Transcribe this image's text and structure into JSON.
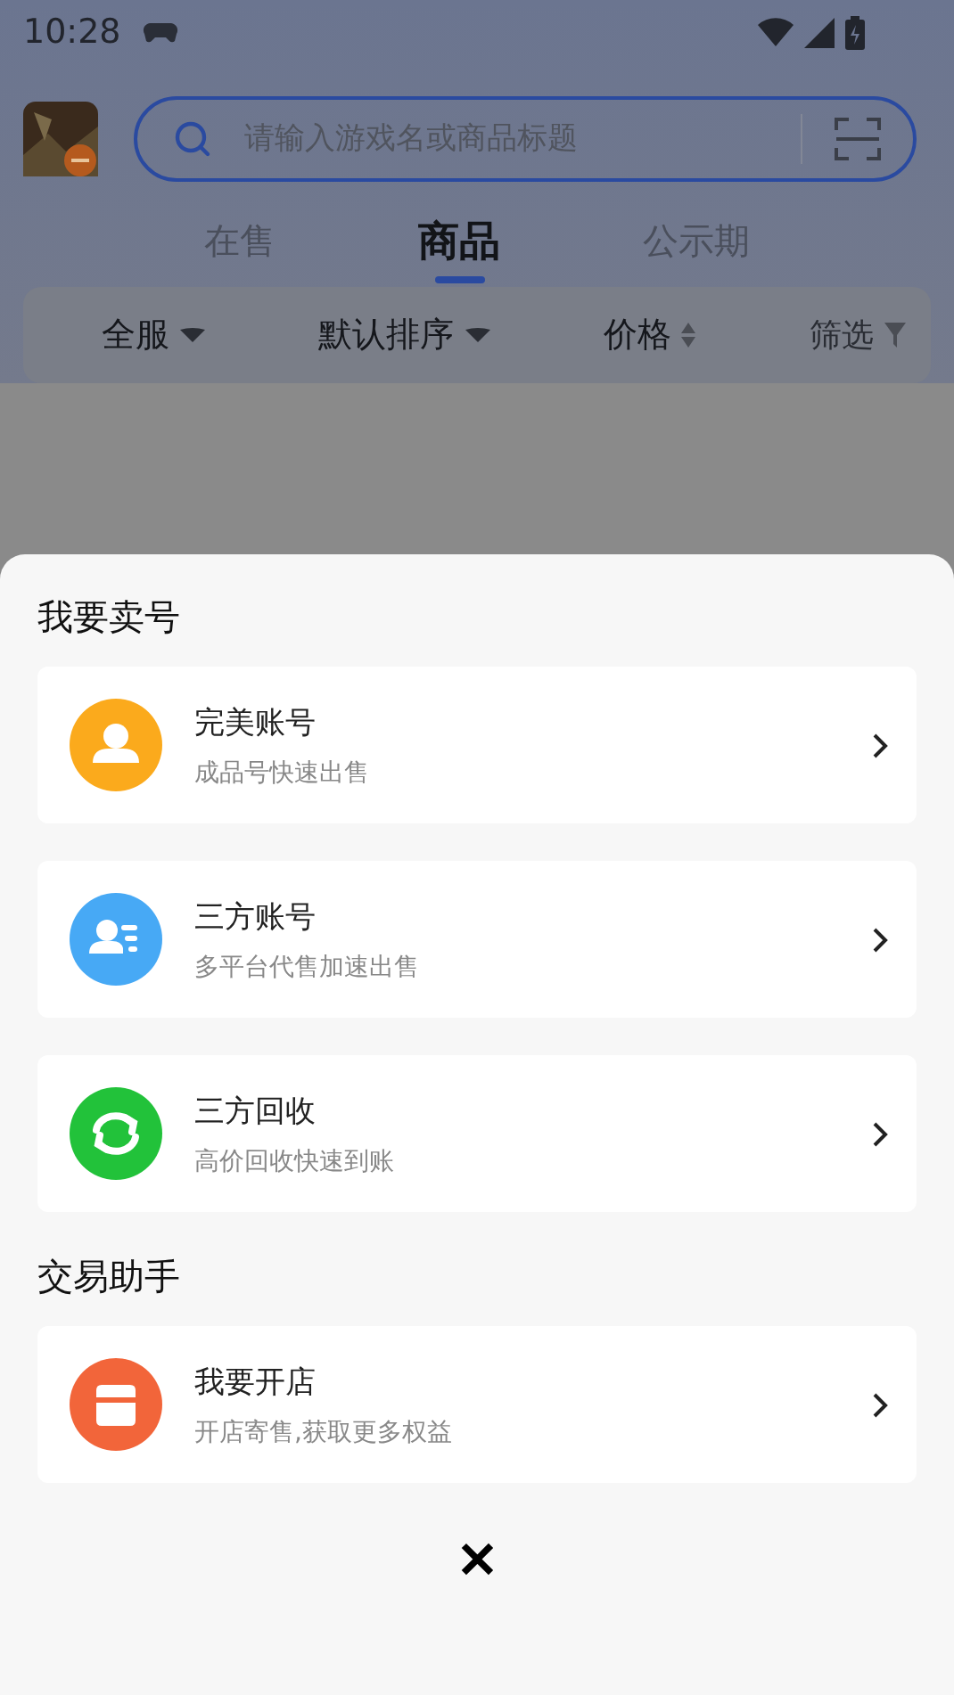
{
  "status_bar": {
    "time": "10:28"
  },
  "search": {
    "placeholder": "请输入游戏名或商品标题"
  },
  "tabs": [
    {
      "label": "在售",
      "selected": false
    },
    {
      "label": "商品",
      "selected": true
    },
    {
      "label": "公示期",
      "selected": false
    }
  ],
  "filters": [
    {
      "label": "全服",
      "kind": "dropdown"
    },
    {
      "label": "默认排序",
      "kind": "dropdown"
    },
    {
      "label": "价格",
      "kind": "sort"
    },
    {
      "label": "筛选",
      "kind": "filter"
    }
  ],
  "sheet": {
    "sections": [
      {
        "title": "我要卖号",
        "items": [
          {
            "title": "完美账号",
            "subtitle": "成品号快速出售",
            "kind": "person",
            "color": "#fbaa1c"
          },
          {
            "title": "三方账号",
            "subtitle": "多平台代售加速出售",
            "kind": "contacts",
            "color": "#47a9f5"
          },
          {
            "title": "三方回收",
            "subtitle": "高价回收快速到账",
            "kind": "recycle",
            "color": "#22c23a"
          }
        ]
      },
      {
        "title": "交易助手",
        "items": [
          {
            "title": "我要开店",
            "subtitle": "开店寄售,获取更多权益",
            "kind": "shop",
            "color": "#f2653a"
          }
        ]
      }
    ],
    "close": "✕"
  }
}
